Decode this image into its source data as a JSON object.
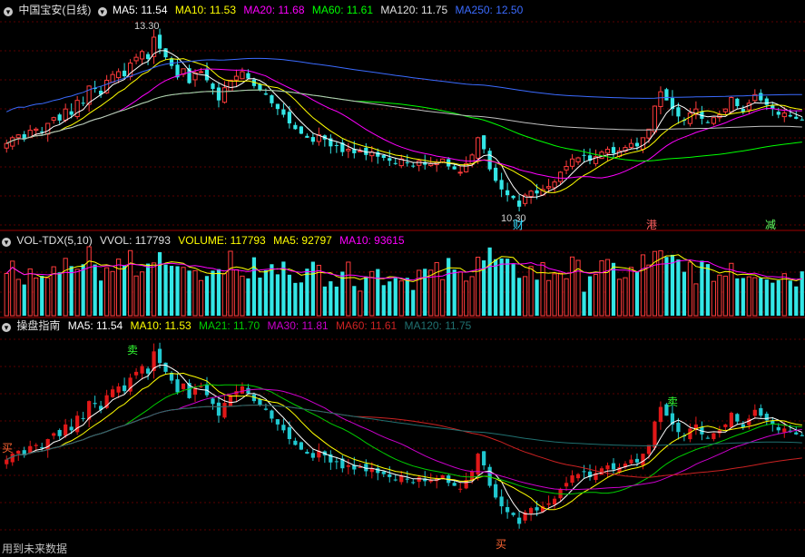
{
  "main_panel": {
    "legend": [
      {
        "text": "中国宝安(日线)",
        "color": "#e0e0e0"
      },
      {
        "text": "MA5: 11.54",
        "color": "#ffffff"
      },
      {
        "text": "MA10: 11.53",
        "color": "#ffff00"
      },
      {
        "text": "MA20: 11.68",
        "color": "#ff00ff"
      },
      {
        "text": "MA60: 11.61",
        "color": "#00ff00"
      },
      {
        "text": "MA120: 11.75",
        "color": "#e0e0e0"
      },
      {
        "text": "MA250: 12.50",
        "color": "#3b6bff"
      }
    ],
    "high_label": "13.30",
    "low_label": "10.30",
    "event_markers": [
      {
        "text": "财",
        "color": "#33ddff"
      },
      {
        "text": "港",
        "color": "#ff6060"
      },
      {
        "text": "减",
        "color": "#60ff60"
      }
    ]
  },
  "volume_panel": {
    "legend": [
      {
        "text": "VOL-TDX(5,10)",
        "color": "#e0e0e0"
      },
      {
        "text": "VVOL: 117793",
        "color": "#e0e0e0"
      },
      {
        "text": "VOLUME: 117793",
        "color": "#ffff00"
      },
      {
        "text": "MA5: 92797",
        "color": "#ffff00"
      },
      {
        "text": "MA10: 93615",
        "color": "#ff00ff"
      }
    ]
  },
  "indicator_panel": {
    "legend": [
      {
        "text": "操盘指南",
        "color": "#e0e0e0"
      },
      {
        "text": "MA5: 11.54",
        "color": "#ffffff"
      },
      {
        "text": "MA10: 11.53",
        "color": "#ffff00"
      },
      {
        "text": "MA21: 11.70",
        "color": "#00cc00"
      },
      {
        "text": "MA30: 11.81",
        "color": "#cc00cc"
      },
      {
        "text": "MA60: 11.61",
        "color": "#cc2222"
      },
      {
        "text": "MA120: 11.75",
        "color": "#207070"
      }
    ],
    "signals": [
      {
        "text": "买",
        "color": "#ff6633"
      },
      {
        "text": "卖",
        "color": "#33ff33"
      },
      {
        "text": "买",
        "color": "#ff6633"
      },
      {
        "text": "卖",
        "color": "#33ff33"
      }
    ]
  },
  "footer_text": "用到未来数据",
  "chart_data": {
    "type": "candlestick",
    "symbol": "中国宝安",
    "period": "日线",
    "ylabel": "",
    "marked_high": 13.3,
    "marked_low": 10.3,
    "ma_last": {
      "MA5": 11.54,
      "MA10": 11.53,
      "MA20": 11.68,
      "MA60": 11.61,
      "MA120": 11.75,
      "MA250": 12.5
    },
    "close": [
      11.45,
      11.55,
      11.6,
      11.52,
      11.68,
      11.7,
      11.65,
      11.8,
      11.9,
      11.85,
      12.05,
      11.95,
      12.2,
      12.15,
      12.45,
      12.4,
      12.3,
      12.55,
      12.65,
      12.7,
      12.62,
      12.85,
      12.95,
      13.05,
      12.92,
      13.3,
      13.1,
      12.95,
      12.8,
      12.6,
      12.75,
      12.5,
      12.68,
      12.7,
      12.55,
      12.4,
      12.2,
      12.42,
      12.55,
      12.62,
      12.7,
      12.58,
      12.45,
      12.38,
      12.3,
      12.15,
      12.05,
      11.95,
      11.8,
      11.7,
      11.62,
      11.55,
      11.48,
      11.6,
      11.52,
      11.4,
      11.42,
      11.3,
      11.35,
      11.28,
      11.32,
      11.25,
      11.3,
      11.22,
      11.2,
      11.15,
      11.1,
      11.18,
      11.12,
      11.05,
      11.15,
      11.08,
      11.1,
      11.12,
      11.18,
      11.05,
      11.0,
      10.95,
      11.1,
      11.25,
      11.55,
      11.35,
      11.0,
      10.8,
      10.65,
      10.55,
      10.5,
      10.35,
      10.55,
      10.62,
      10.58,
      10.65,
      10.7,
      10.78,
      10.95,
      11.05,
      11.18,
      11.2,
      11.25,
      11.15,
      11.22,
      11.3,
      11.35,
      11.28,
      11.32,
      11.38,
      11.45,
      11.4,
      11.55,
      11.7,
      12.1,
      12.35,
      12.2,
      12.05,
      11.92,
      11.85,
      11.98,
      12.05,
      11.88,
      11.82,
      11.9,
      11.95,
      12.05,
      12.25,
      12.1,
      12.0,
      12.15,
      12.3,
      12.2,
      12.12,
      12.05,
      11.95,
      11.98,
      11.92,
      11.88,
      11.85
    ],
    "volume_ma5": 92797,
    "volume_ma10": 93615,
    "volume_last": 117793
  }
}
